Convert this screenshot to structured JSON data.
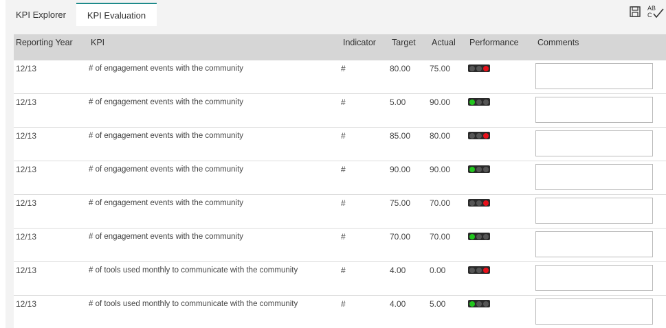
{
  "tabs": [
    {
      "label": "KPI Explorer",
      "active": false
    },
    {
      "label": "KPI Evaluation",
      "active": true
    }
  ],
  "toolbar": {
    "icons": [
      "save-icon",
      "spellcheck-icon"
    ],
    "spellcheck_text": "AB C"
  },
  "grid": {
    "columns": [
      "Reporting Year",
      "KPI",
      "Indicator",
      "Target",
      "Actual",
      "Performance",
      "Comments"
    ],
    "rows": [
      {
        "year": "12/13",
        "kpi": "# of engagement events with the community",
        "indicator": "#",
        "target": "80.00",
        "actual": "75.00",
        "performance": "red",
        "comment": ""
      },
      {
        "year": "12/13",
        "kpi": "# of engagement events with the community",
        "indicator": "#",
        "target": "5.00",
        "actual": "90.00",
        "performance": "green",
        "comment": ""
      },
      {
        "year": "12/13",
        "kpi": "# of engagement events with the community",
        "indicator": "#",
        "target": "85.00",
        "actual": "80.00",
        "performance": "red",
        "comment": ""
      },
      {
        "year": "12/13",
        "kpi": "# of engagement events with the community",
        "indicator": "#",
        "target": "90.00",
        "actual": "90.00",
        "performance": "green",
        "comment": ""
      },
      {
        "year": "12/13",
        "kpi": "# of engagement events with the community",
        "indicator": "#",
        "target": "75.00",
        "actual": "70.00",
        "performance": "red",
        "comment": ""
      },
      {
        "year": "12/13",
        "kpi": "# of engagement events with the community",
        "indicator": "#",
        "target": "70.00",
        "actual": "70.00",
        "performance": "green",
        "comment": ""
      },
      {
        "year": "12/13",
        "kpi": "# of tools used monthly to communicate with the community",
        "indicator": "#",
        "target": "4.00",
        "actual": "0.00",
        "performance": "red",
        "comment": ""
      },
      {
        "year": "12/13",
        "kpi": "# of tools used monthly to communicate with the community",
        "indicator": "#",
        "target": "4.00",
        "actual": "5.00",
        "performance": "green",
        "comment": ""
      }
    ]
  },
  "colors": {
    "accent": "#1e8a8a",
    "header_bg": "#d6d6d6",
    "light_red": "#e8101a",
    "light_green": "#22c61e",
    "light_off": "#555555"
  }
}
